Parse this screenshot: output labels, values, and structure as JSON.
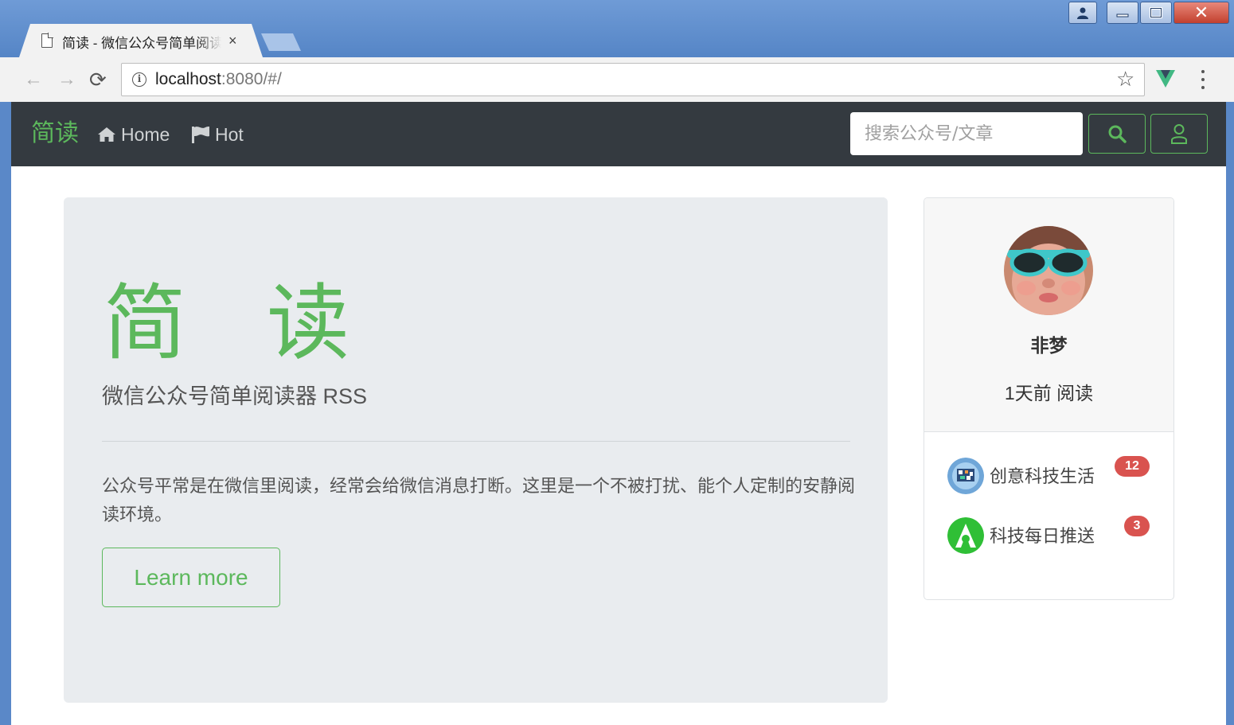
{
  "browser": {
    "tab_title": "简读 - 微信公众号简单阅读器 RSS",
    "tab_close": "×",
    "url_host": "localhost",
    "url_rest": ":8080/#/",
    "nav_back": "←",
    "nav_forward": "→",
    "nav_reload": "⟳",
    "bookmark": "☆",
    "window_close": "✕"
  },
  "navbar": {
    "brand": "简读",
    "links": [
      {
        "label": "Home",
        "icon": "home-icon"
      },
      {
        "label": "Hot",
        "icon": "flag-icon"
      }
    ],
    "search_placeholder": "搜索公众号/文章"
  },
  "jumbotron": {
    "title": "简 读",
    "lead": "微信公众号简单阅读器 RSS",
    "text": "公众号平常是在微信里阅读，经常会给微信消息打断。这里是一个不被打扰、能个人定制的安静阅读环境。",
    "button": "Learn more"
  },
  "profile": {
    "name": "非梦",
    "status": "1天前 阅读",
    "subscriptions": [
      {
        "name": "创意科技生活",
        "count": "12"
      },
      {
        "name": "科技每日推送",
        "count": "3"
      }
    ]
  },
  "colors": {
    "brand_green": "#5cb85c",
    "navbar_bg": "#343a40",
    "badge_red": "#d9534f",
    "jumbotron_bg": "#e9ecef"
  }
}
